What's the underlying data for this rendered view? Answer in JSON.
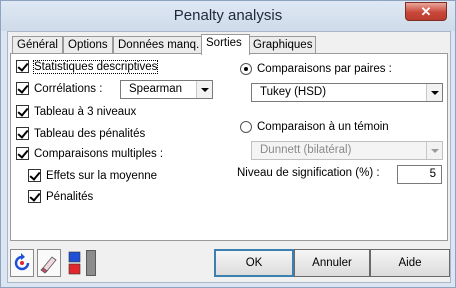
{
  "window": {
    "title": "Penalty analysis",
    "close_glyph": "✕"
  },
  "tabs": [
    {
      "label": "Général"
    },
    {
      "label": "Options"
    },
    {
      "label": "Données manq."
    },
    {
      "label": "Sorties",
      "active": true
    },
    {
      "label": "Graphiques"
    }
  ],
  "left": {
    "descriptive_stats": {
      "label": "Statistiques descriptives",
      "checked": true
    },
    "correlations": {
      "label": "Corrélations :",
      "checked": true,
      "method": "Spearman"
    },
    "three_level_table": {
      "label": "Tableau à 3 niveaux",
      "checked": true
    },
    "penalties_table": {
      "label": "Tableau des pénalités",
      "checked": true
    },
    "multiple_comparisons": {
      "label": "Comparaisons multiples :",
      "checked": true
    },
    "mean_effects": {
      "label": "Effets sur la moyenne",
      "checked": true
    },
    "penalties": {
      "label": "Pénalités",
      "checked": true
    }
  },
  "right": {
    "pairwise": {
      "label": "Comparaisons par paires :",
      "selected": true,
      "method": "Tukey (HSD)"
    },
    "control": {
      "label": "Comparaison à un témoin",
      "selected": false,
      "method": "Dunnett (bilatéral)"
    },
    "significance": {
      "label": "Niveau de signification (%) :",
      "value": "5"
    }
  },
  "toolbar": {
    "icons": [
      "reset-icon",
      "eraser-icon",
      "color-squares-icon",
      "gray-bar-icon"
    ],
    "colors": {
      "blue": "#1f4fd6",
      "red": "#e3262b",
      "gray": "#8c8c8c"
    }
  },
  "buttons": {
    "ok": "OK",
    "cancel": "Annuler",
    "help": "Aide"
  }
}
